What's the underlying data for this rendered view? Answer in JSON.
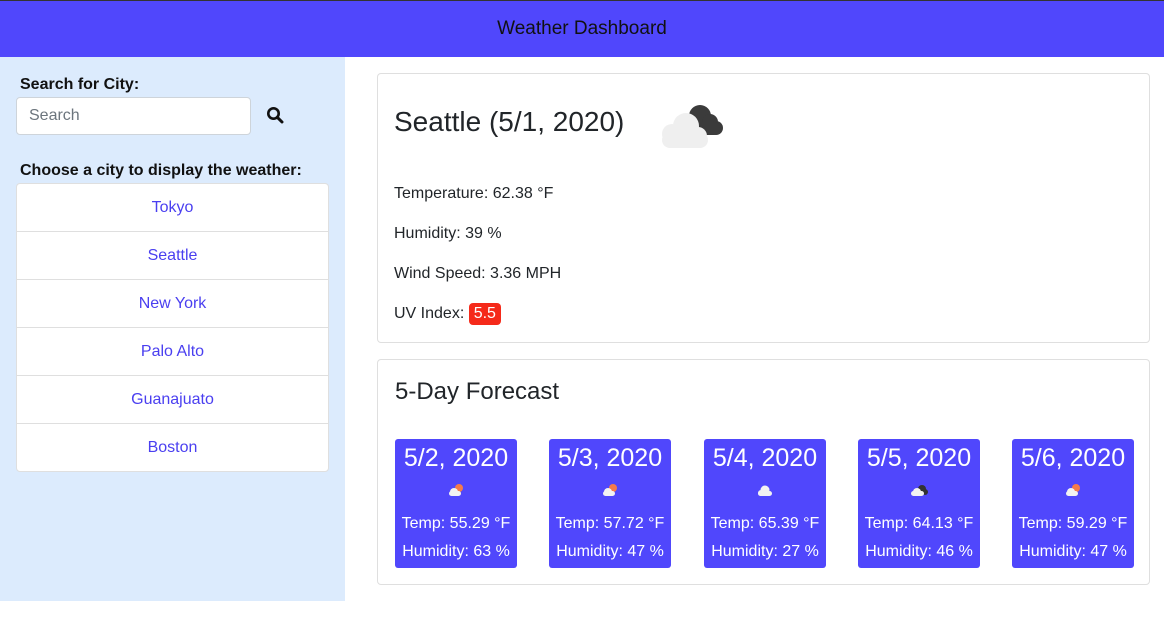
{
  "header": {
    "title": "Weather Dashboard"
  },
  "sidebar": {
    "search_label": "Search for City:",
    "search_placeholder": "Search",
    "search_value": "",
    "choose_label": "Choose a city to display the weather:",
    "cities": [
      "Tokyo",
      "Seattle",
      "New York",
      "Palo Alto",
      "Guanajuato",
      "Boston"
    ]
  },
  "current": {
    "title": "Seattle (5/1, 2020)",
    "icon": "cloud-dark-icon",
    "temperature": "Temperature: 62.38 °F",
    "humidity": "Humidity: 39 %",
    "wind": "Wind Speed: 3.36 MPH",
    "uv_label": "UV Index: ",
    "uv_value": "5.5"
  },
  "forecast": {
    "title": "5-Day Forecast",
    "days": [
      {
        "date": "5/2, 2020",
        "icon": "sun-cloud-icon",
        "temp": "Temp: 55.29 °F",
        "humidity": "Humidity: 63 %"
      },
      {
        "date": "5/3, 2020",
        "icon": "sun-cloud-icon",
        "temp": "Temp: 57.72 °F",
        "humidity": "Humidity: 47 %"
      },
      {
        "date": "5/4, 2020",
        "icon": "cloud-icon",
        "temp": "Temp: 65.39 °F",
        "humidity": "Humidity: 27 %"
      },
      {
        "date": "5/5, 2020",
        "icon": "cloud-dark-icon",
        "temp": "Temp: 64.13 °F",
        "humidity": "Humidity: 46 %"
      },
      {
        "date": "5/6, 2020",
        "icon": "sun-cloud-icon",
        "temp": "Temp: 59.29 °F",
        "humidity": "Humidity: 47 %"
      }
    ]
  },
  "colors": {
    "accent": "#5047fc",
    "sidebar_bg": "#dcebfd",
    "uv_badge": "#f52a1a",
    "link": "#4a3ff0"
  }
}
